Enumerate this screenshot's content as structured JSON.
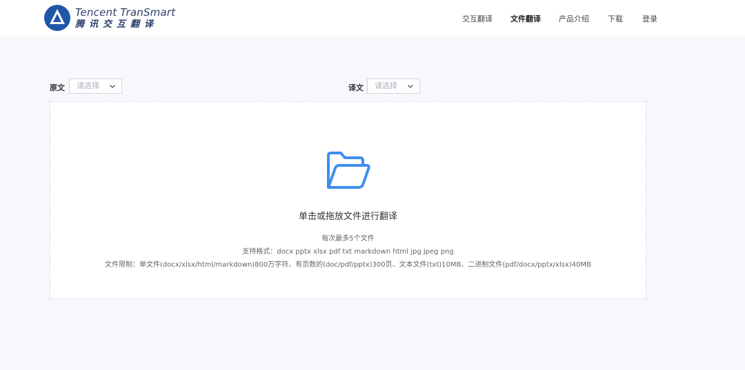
{
  "brand": {
    "name_en": "Tencent TranSmart",
    "name_cn": "腾讯交互翻译",
    "accent": "#1f56a8"
  },
  "nav": {
    "items": [
      {
        "label": "交互翻译",
        "active": false
      },
      {
        "label": "文件翻译",
        "active": true
      },
      {
        "label": "产品介绍",
        "active": false
      },
      {
        "label": "下载",
        "active": false
      },
      {
        "label": "登录",
        "active": false
      }
    ]
  },
  "source": {
    "label": "原文",
    "placeholder": "请选择"
  },
  "target": {
    "label": "译文",
    "placeholder": "请选择"
  },
  "dropzone": {
    "icon": "folder-open-icon",
    "icon_color": "#3d8ef0",
    "title": "单击或拖放文件进行翻译",
    "max_files": "每次最多5个文件",
    "formats": "支持格式：docx pptx xlsx pdf txt markdown html jpg jpeg png",
    "limits": "文件限制：单文件(docx/xlsx/html/markdown)800万字符、有页数的(doc/pdf/pptx)300页、文本文件(txt)10MB、二进制文件(pdf/docx/pptx/xlsx)40MB"
  }
}
